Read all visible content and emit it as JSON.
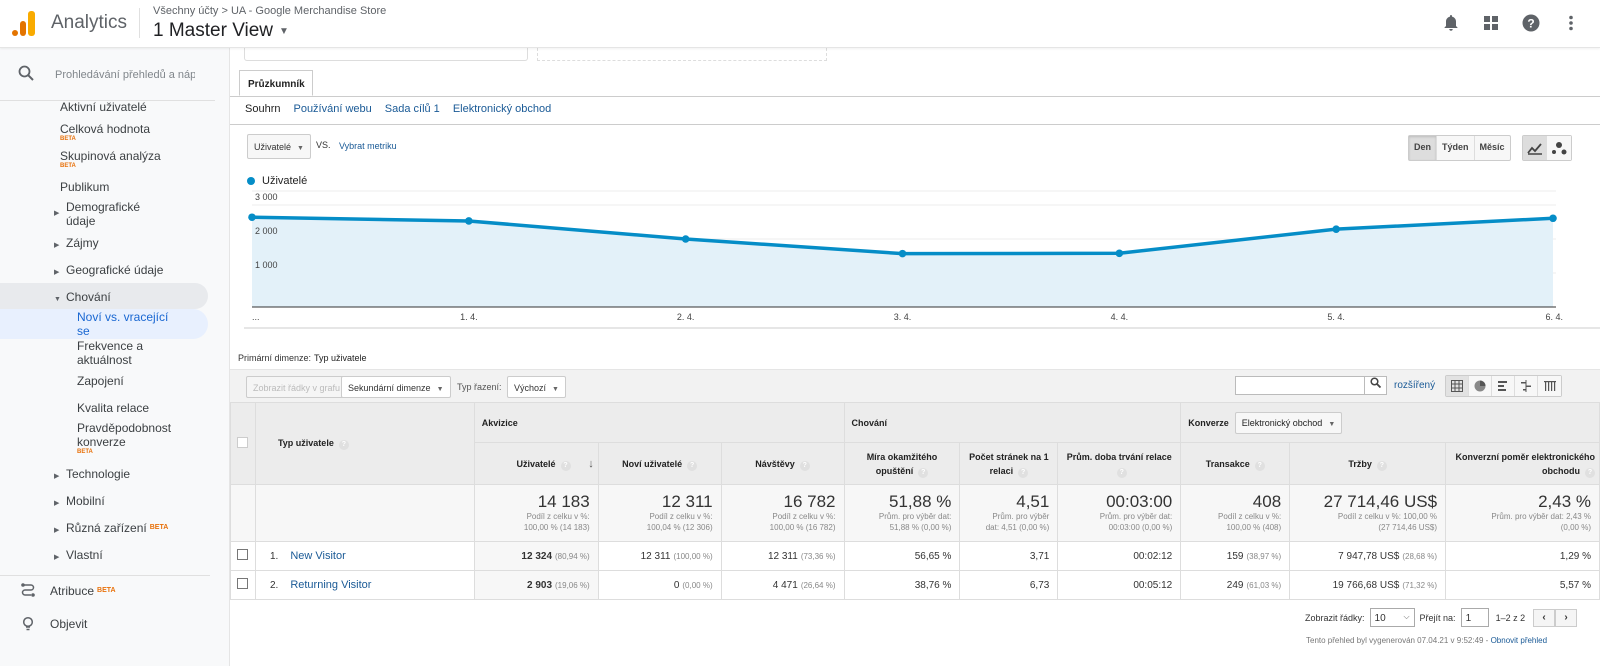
{
  "header": {
    "brand": "Analytics",
    "breadcrumb": "Všechny účty > UA - Google Merchandise Store",
    "view_title": "1 Master View",
    "icons": [
      "bell-icon",
      "apps-icon",
      "help-icon",
      "more-vert-icon"
    ]
  },
  "sidebar": {
    "search_placeholder": "Prohledávání přehledů a náp",
    "items": [
      {
        "label": "Aktivní uživatelé"
      },
      {
        "label": "Celková hodnota",
        "badge": "BETA"
      },
      {
        "label": "Skupinová analýza",
        "badge": "BETA"
      },
      {
        "label": "Publikum"
      },
      {
        "label": "Demografické údaje"
      },
      {
        "label": "Zájmy"
      },
      {
        "label": "Geografické údaje"
      },
      {
        "label": "Chování"
      },
      {
        "label": "Noví vs. vracející se"
      },
      {
        "label": "Frekvence a aktuálnost"
      },
      {
        "label": "Zapojení"
      },
      {
        "label": "Kvalita relace"
      },
      {
        "label": "Pravděpodobnost konverze",
        "badge": "BETA"
      },
      {
        "label": "Technologie"
      },
      {
        "label": "Mobilní"
      },
      {
        "label": "Různá zařízení",
        "badge": "BETA"
      },
      {
        "label": "Vlastní"
      }
    ],
    "bottom": [
      {
        "label": "Atribuce",
        "badge": "BETA",
        "icon": "attribution-icon"
      },
      {
        "label": "Objevit",
        "icon": "lightbulb-icon"
      }
    ]
  },
  "main": {
    "tab": "Průzkumník",
    "subtabs": [
      "Souhrn",
      "Používání webu",
      "Sada cílů 1",
      "Elektronický obchod"
    ],
    "metric_select": "Uživatelé",
    "vs": "VS.",
    "pick_metric": "Vybrat metriku",
    "periods": [
      "Den",
      "Týden",
      "Měsíc"
    ],
    "active_period": "Den",
    "legend": "Uživatelé",
    "series_color": "#058dc7"
  },
  "chart_data": {
    "type": "area",
    "title": "",
    "series": [
      {
        "name": "Uživatelé",
        "values": [
          2640,
          2530,
          2000,
          1570,
          1580,
          2290,
          2610
        ]
      }
    ],
    "categories": [
      "...",
      "1. 4.",
      "2. 4.",
      "3. 4.",
      "4. 4.",
      "5. 4.",
      "6. 4."
    ],
    "yticks": [
      "1 000",
      "2 000",
      "3 000"
    ],
    "ylim": [
      0,
      3000
    ],
    "grid": true,
    "legend_placement": "top-left"
  },
  "table_controls": {
    "primary_dim_label": "Primární dimenze:",
    "primary_dim_value": "Typ uživatele",
    "plot_rows": "Zobrazit řádky v grafu",
    "secondary_dim": "Sekundární dimenze",
    "sort_label": "Typ řazení:",
    "sort_value": "Výchozí",
    "search_value": "",
    "advanced": "rozšířený"
  },
  "table": {
    "dim_header": "Typ uživatele",
    "groups": {
      "acq": "Akvizice",
      "beh": "Chování",
      "conv": "Konverze",
      "conv_select": "Elektronický obchod"
    },
    "columns": [
      "Uživatelé",
      "Noví uživatelé",
      "Návštěvy",
      "Míra okamžitého opuštění",
      "Počet stránek na 1 relaci",
      "Prům. doba trvání relace",
      "Transakce",
      "Tržby",
      "Konverzní poměr elektronického obchodu"
    ],
    "totals": [
      {
        "value": "14 183",
        "sub1": "Podíl z celku v %:",
        "sub2": "100,00 % (14 183)"
      },
      {
        "value": "12 311",
        "sub1": "Podíl z celku v %:",
        "sub2": "100,04 % (12 306)"
      },
      {
        "value": "16 782",
        "sub1": "Podíl z celku v %:",
        "sub2": "100,00 % (16 782)"
      },
      {
        "value": "51,88 %",
        "sub1": "Prům. pro výběr dat:",
        "sub2": "51,88 % (0,00 %)"
      },
      {
        "value": "4,51",
        "sub1": "Prům. pro výběr",
        "sub2": "dat: 4,51 (0,00 %)"
      },
      {
        "value": "00:03:00",
        "sub1": "Prům. pro výběr dat:",
        "sub2": "00:03:00 (0,00 %)"
      },
      {
        "value": "408",
        "sub1": "Podíl z celku v %:",
        "sub2": "100,00 % (408)"
      },
      {
        "value": "27 714,46 US$",
        "sub1": "Podíl z celku v %: 100,00 %",
        "sub2": "(27 714,46 US$)"
      },
      {
        "value": "2,43 %",
        "sub1": "Prům. pro výběr dat: 2,43 %",
        "sub2": "(0,00 %)"
      }
    ],
    "rows": [
      {
        "idx": "1.",
        "name": "New Visitor",
        "cells": [
          {
            "v": "12 324",
            "p": "(80,94 %)"
          },
          {
            "v": "12 311",
            "p": "(100,00 %)"
          },
          {
            "v": "12 311",
            "p": "(73,36 %)"
          },
          {
            "v": "56,65 %",
            "p": ""
          },
          {
            "v": "3,71",
            "p": ""
          },
          {
            "v": "00:02:12",
            "p": ""
          },
          {
            "v": "159",
            "p": "(38,97 %)"
          },
          {
            "v": "7 947,78 US$",
            "p": "(28,68 %)"
          },
          {
            "v": "1,29 %",
            "p": ""
          }
        ]
      },
      {
        "idx": "2.",
        "name": "Returning Visitor",
        "cells": [
          {
            "v": "2 903",
            "p": "(19,06 %)"
          },
          {
            "v": "0",
            "p": "(0,00 %)"
          },
          {
            "v": "4 471",
            "p": "(26,64 %)"
          },
          {
            "v": "38,76 %",
            "p": ""
          },
          {
            "v": "6,73",
            "p": ""
          },
          {
            "v": "00:05:12",
            "p": ""
          },
          {
            "v": "249",
            "p": "(61,03 %)"
          },
          {
            "v": "19 766,68 US$",
            "p": "(71,32 %)"
          },
          {
            "v": "5,57 %",
            "p": ""
          }
        ]
      }
    ]
  },
  "pager": {
    "show_rows_label": "Zobrazit řádky:",
    "show_rows_value": "10",
    "goto_label": "Přejít na:",
    "goto_value": "1",
    "range": "1–2 z 2",
    "generated": "Tento přehled byl vygenerován 07.04.21 v 9:52:49 - ",
    "refresh": "Obnovit přehled"
  }
}
